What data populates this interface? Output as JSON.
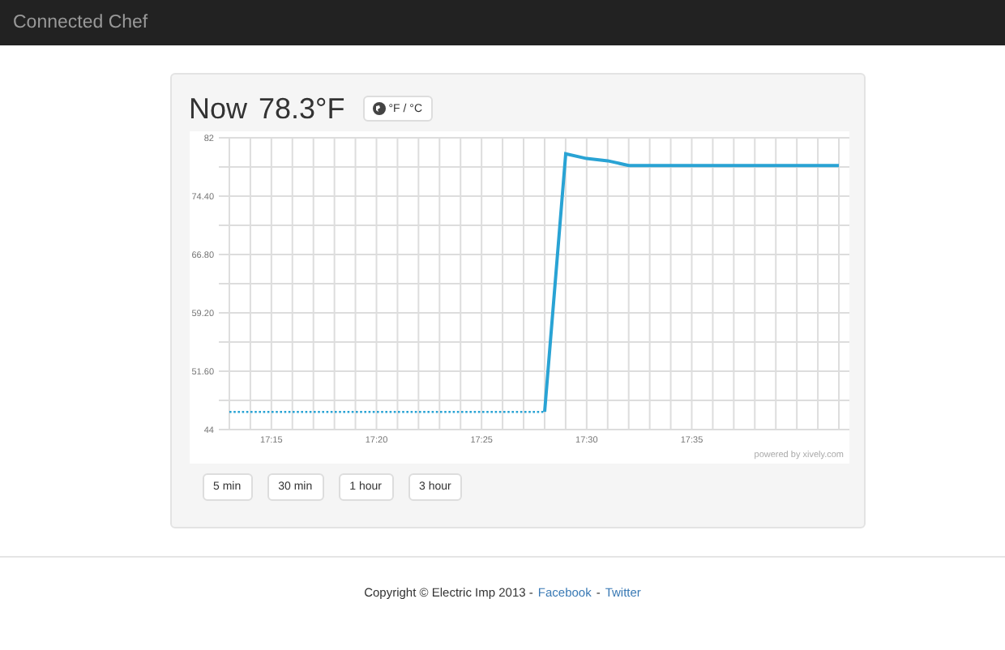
{
  "navbar": {
    "brand": "Connected Chef"
  },
  "reading": {
    "label": "Now",
    "value": "78.3°F",
    "unit_button": "°F / °C"
  },
  "chart": {
    "credit": "powered by xively.com",
    "chart_data": {
      "type": "line",
      "categories": [
        null,
        null,
        "17:15",
        null,
        null,
        null,
        null,
        "17:20",
        null,
        null,
        null,
        null,
        "17:25",
        null,
        null,
        null,
        null,
        "17:30",
        null,
        null,
        null,
        null,
        "17:35",
        null,
        null,
        null,
        null,
        null,
        null,
        null
      ],
      "ylim": [
        44,
        82
      ],
      "grid": true,
      "yticks": [
        {
          "value": 44,
          "label": "44"
        },
        {
          "value": 51.6,
          "label": "51.60"
        },
        {
          "value": 59.2,
          "label": "59.20"
        },
        {
          "value": 66.8,
          "label": "66.80"
        },
        {
          "value": 74.4,
          "label": "74.40"
        },
        {
          "value": 82,
          "label": "82"
        }
      ],
      "series": [
        {
          "color": "#29a3d4",
          "line_style": "dotted",
          "values": [
            46.3,
            46.3,
            46.3,
            46.3,
            46.3,
            46.3,
            46.3,
            46.3,
            46.3,
            46.3,
            46.3,
            46.3,
            46.3,
            46.3,
            46.3,
            46.3,
            null,
            null,
            null,
            null,
            null,
            null,
            null,
            null,
            null,
            null,
            null,
            null,
            null,
            null
          ]
        },
        {
          "color": "#29a3d4",
          "line_style": "solid",
          "values": [
            null,
            null,
            null,
            null,
            null,
            null,
            null,
            null,
            null,
            null,
            null,
            null,
            null,
            null,
            null,
            46.3,
            79.9,
            79.3,
            79.0,
            78.4,
            78.4,
            78.4,
            78.4,
            78.4,
            78.4,
            78.4,
            78.4,
            78.4,
            78.4,
            78.4
          ]
        }
      ]
    }
  },
  "ranges": [
    {
      "label": "5 min"
    },
    {
      "label": "30 min"
    },
    {
      "label": "1 hour"
    },
    {
      "label": "3 hour"
    }
  ],
  "footer": {
    "copyright": "Copyright © Electric Imp 2013 -",
    "links": [
      {
        "label": "Facebook"
      },
      {
        "label": "Twitter"
      }
    ],
    "separator": "-"
  }
}
